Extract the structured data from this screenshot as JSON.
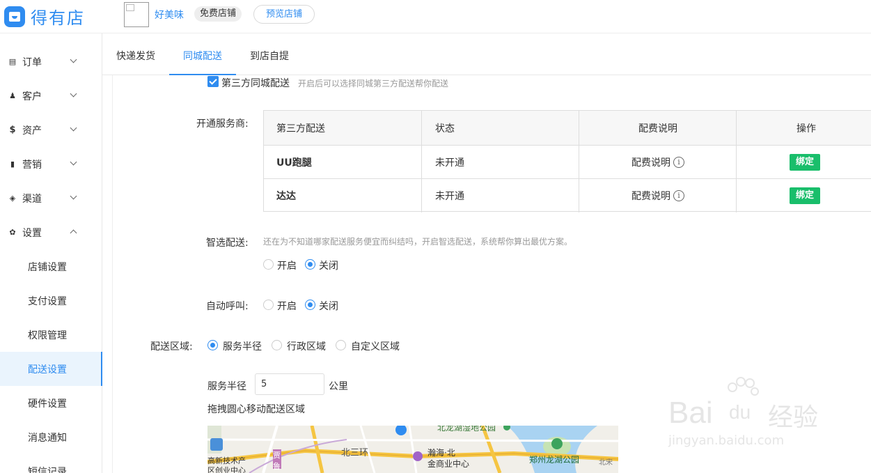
{
  "header": {
    "app_name": "得有店",
    "store_name": "好美味",
    "store_badge": "免费店铺",
    "preview_button": "预览店铺"
  },
  "sidebar": {
    "items": [
      {
        "label": "订单",
        "icon": "list-icon"
      },
      {
        "label": "客户",
        "icon": "users-icon"
      },
      {
        "label": "资产",
        "icon": "dollar-icon"
      },
      {
        "label": "营销",
        "icon": "bar-chart-icon"
      },
      {
        "label": "渠道",
        "icon": "layers-icon"
      },
      {
        "label": "设置",
        "icon": "gear-icon"
      }
    ],
    "settings_sub": [
      {
        "label": "店铺设置"
      },
      {
        "label": "支付设置"
      },
      {
        "label": "权限管理"
      },
      {
        "label": "配送设置",
        "active": true
      },
      {
        "label": "硬件设置"
      },
      {
        "label": "消息通知"
      },
      {
        "label": "短信记录"
      }
    ]
  },
  "tabs": [
    {
      "label": "快递发货"
    },
    {
      "label": "同城配送",
      "active": true
    },
    {
      "label": "到店自提"
    }
  ],
  "third_party": {
    "checkbox_label": "第三方同城配送",
    "checked": true,
    "hint": "开启后可以选择同城第三方配送帮你配送"
  },
  "providers": {
    "label": "开通服务商:",
    "headers": [
      "第三方配送",
      "状态",
      "配费说明",
      "操作"
    ],
    "rows": [
      {
        "name": "UU跑腿",
        "status": "未开通",
        "fee": "配费说明",
        "action": "绑定"
      },
      {
        "name": "达达",
        "status": "未开通",
        "fee": "配费说明",
        "action": "绑定"
      }
    ]
  },
  "smart_delivery": {
    "label": "智选配送:",
    "hint": "还在为不知道哪家配送服务便宜而纠结吗，开启智选配送，系统帮你算出最优方案。",
    "options": [
      "开启",
      "关闭"
    ],
    "selected": "关闭"
  },
  "auto_call": {
    "label": "自动呼叫:",
    "options": [
      "开启",
      "关闭"
    ],
    "selected": "关闭"
  },
  "delivery_area": {
    "label": "配送区域:",
    "options": [
      "服务半径",
      "行政区域",
      "自定义区域"
    ],
    "selected": "服务半径",
    "radius_label": "服务半径",
    "radius_value": "5",
    "radius_unit": "公里",
    "drag_hint": "拖拽圆心移动配送区域"
  },
  "map": {
    "labels": [
      "北龙湖湿地公园",
      "北三环",
      "瀚海·北",
      "金商业中心",
      "郑州龙湖公园",
      "北宋",
      "高新技术产",
      "区创业中心",
      "贾",
      "鲁"
    ]
  },
  "watermark": {
    "brand": "Bai",
    "brand_du": "du",
    "product": "经验",
    "url": "jingyan.baidu.com"
  },
  "colors": {
    "accent": "#2f8cf0",
    "success": "#19be6b"
  }
}
